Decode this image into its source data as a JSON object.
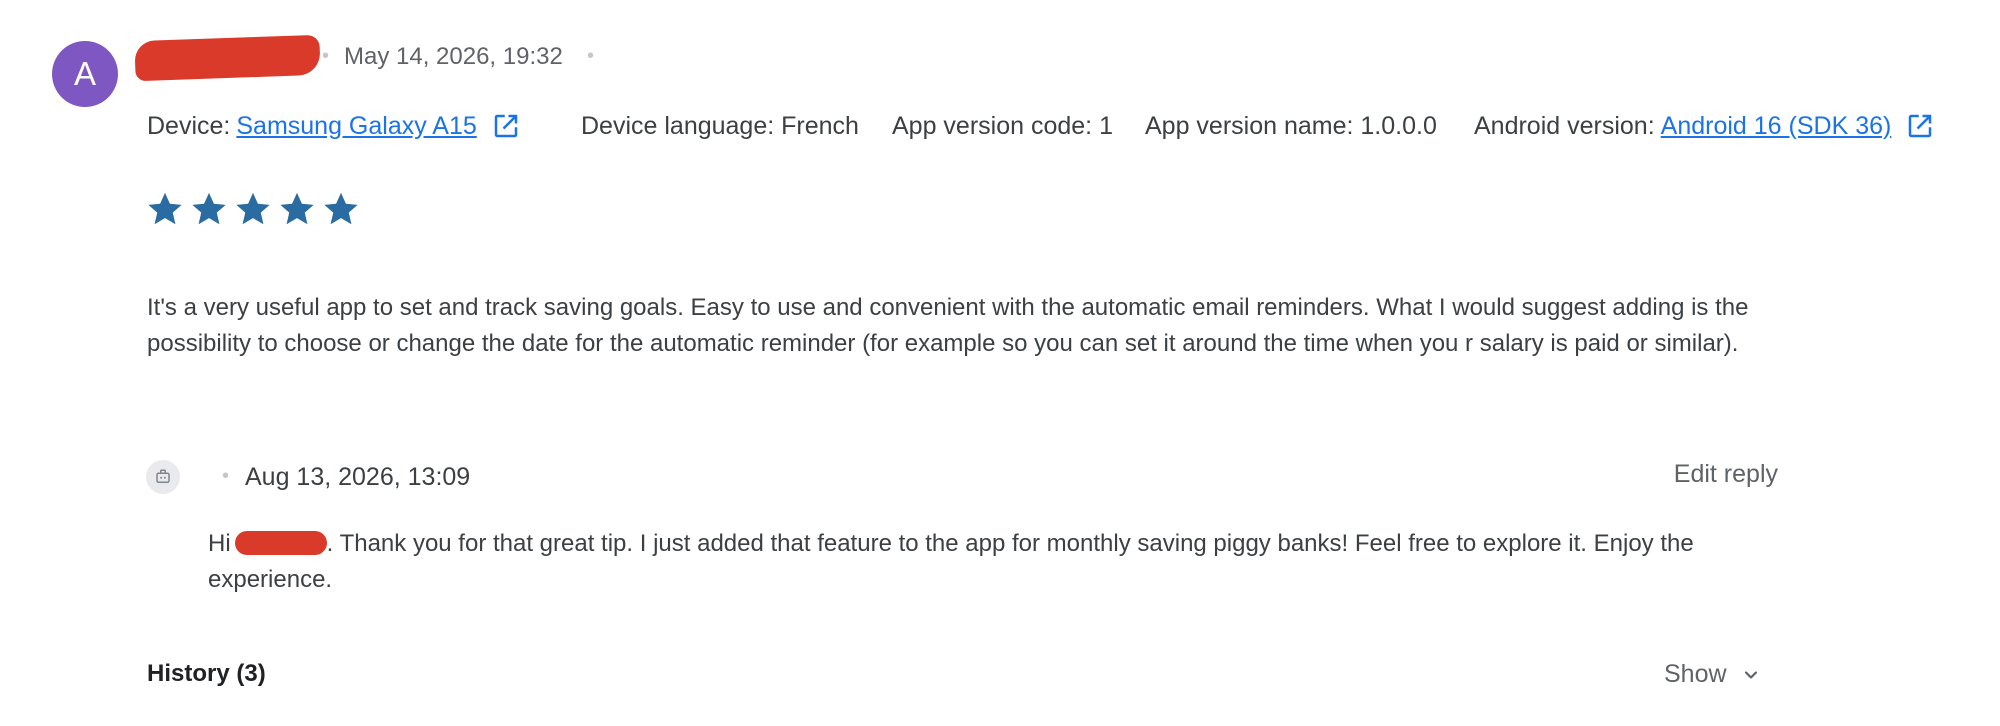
{
  "review": {
    "avatar_letter": "A",
    "date": "May 14, 2026, 19:32",
    "device_label": "Device:",
    "device_value": "Samsung Galaxy A15",
    "device_language": "Device language: French",
    "app_version_code": "App version code: 1",
    "app_version_name": "App version name: 1.0.0.0",
    "android_version_label": "Android version:",
    "android_version_value": "Android 16 (SDK 36)",
    "rating": 5,
    "text": "It's a very useful app to set and track saving goals. Easy to use and convenient with the automatic email reminders. What I would suggest adding is the possibility to choose or change the date for the automatic reminder (for example so you can set it around the time when you r salary is paid or similar)."
  },
  "reply": {
    "date": "Aug 13, 2026, 13:09",
    "edit_label": "Edit reply",
    "greeting": "Hi",
    "text": ". Thank you for that great tip. I just added that feature to the app for monthly saving piggy banks! Feel free to explore it. Enjoy the experience."
  },
  "history": {
    "label": "History (3)",
    "show_label": "Show"
  },
  "colors": {
    "avatar": "#7e57c2",
    "star": "#2a6ba1",
    "link": "#1a73e8",
    "redaction": "#d93a2a"
  },
  "icons": [
    "open-in-new-icon",
    "star-icon",
    "developer-reply-icon",
    "chevron-down-icon"
  ]
}
